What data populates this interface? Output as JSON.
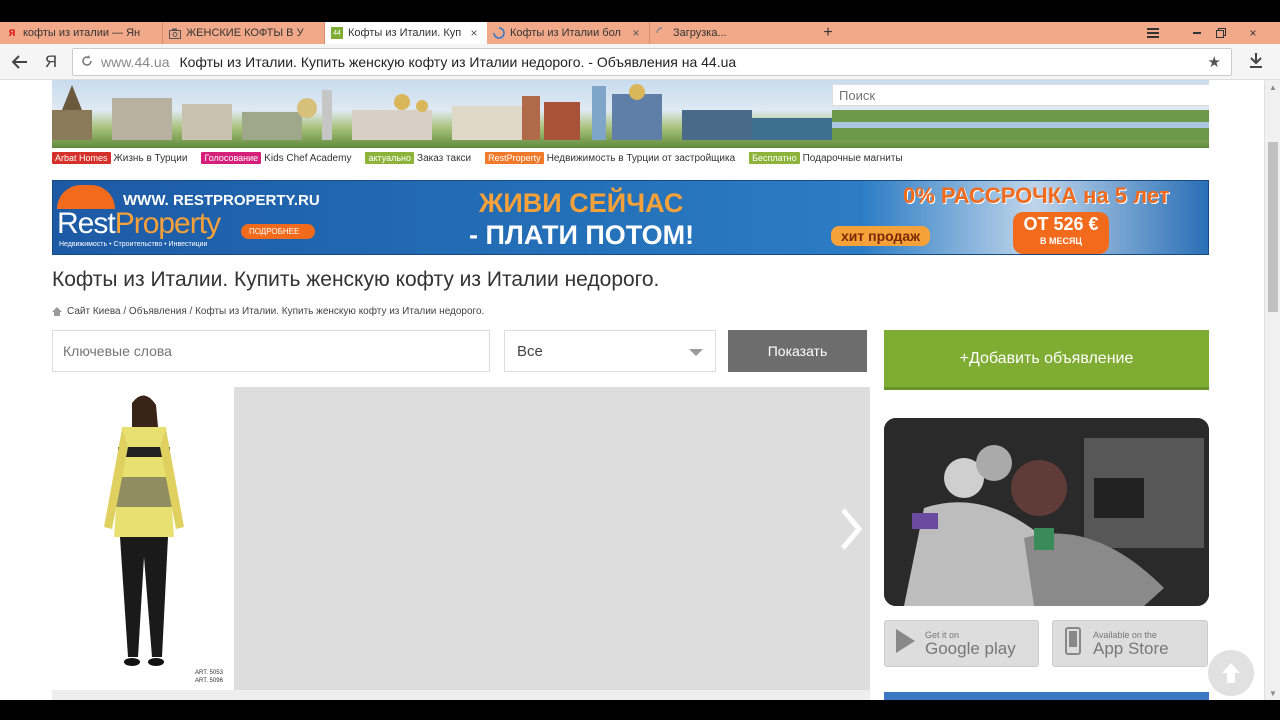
{
  "browser": {
    "tabs": [
      {
        "title": "кофты из италии — Ян",
        "favicon": "yandex-icon",
        "active": false
      },
      {
        "title": "ЖЕНСКИЕ КОФТЫ В У",
        "favicon": "camera-icon",
        "active": false
      },
      {
        "title": "Кофты из Италии. Куп",
        "favicon": "44ua-icon",
        "active": true
      },
      {
        "title": "Кофты из Италии бол",
        "favicon": "loading-icon",
        "active": false
      },
      {
        "title": "Загрузка...",
        "favicon": "loading-icon",
        "active": false
      }
    ],
    "new_tab": "+",
    "close_glyph": "×",
    "address": {
      "domain": "www.44.ua",
      "page_title": "Кофты из Италии. Купить женскую кофту из Италии недорого. - Объявления на 44.ua"
    },
    "yandex_label": "Я"
  },
  "header": {
    "search_placeholder": "Поиск",
    "tags": [
      {
        "tag": "Arbat Homes",
        "text": "Жизнь в Турции",
        "color": "#d6302a"
      },
      {
        "tag": "Голосование",
        "text": "Kids Chef Academy",
        "color": "#d61f7a"
      },
      {
        "tag": "актуально",
        "text": "Заказ такси",
        "color": "#8db33b"
      },
      {
        "tag": "RestProperty",
        "text": "Недвижимость в Турции от застройщика",
        "color": "#f07a2a"
      },
      {
        "tag": "Бесплатно",
        "text": "Подарочные магниты",
        "color": "#8db33b"
      }
    ]
  },
  "ad": {
    "site": "WWW. RESTPROPERTY.RU",
    "brand_a": "Rest",
    "brand_b": "Property",
    "sub": "Недвижимость • Строительство • Инвестиции",
    "more": "ПОДРОБНЕЕ",
    "slogan1": "ЖИВИ СЕЙЧАС",
    "slogan2": "- ПЛАТИ ПОТОМ!",
    "promo": "0% РАССРОЧКА на 5 лет",
    "hit": "хит продаж",
    "price": "ОТ 526 €",
    "price_sub": "В МЕСЯЦ"
  },
  "main": {
    "title": "Кофты из Италии. Купить женскую кофту из Италии недорого.",
    "breadcrumb": "Сайт Киева / Объявления / Кофты из Италии. Купить женскую кофту из Италии недорого.",
    "keywords_placeholder": "Ключевые слова",
    "category_selected": "Все",
    "show_button": "Показать",
    "add_button": "+Добавить объявление",
    "art_1": "ART. 5053",
    "art_2": "ART. 5096"
  },
  "stores": {
    "google_top": "Get it on",
    "google_bottom": "Google play",
    "apple_top": "Available on the",
    "apple_bottom": "App Store"
  }
}
